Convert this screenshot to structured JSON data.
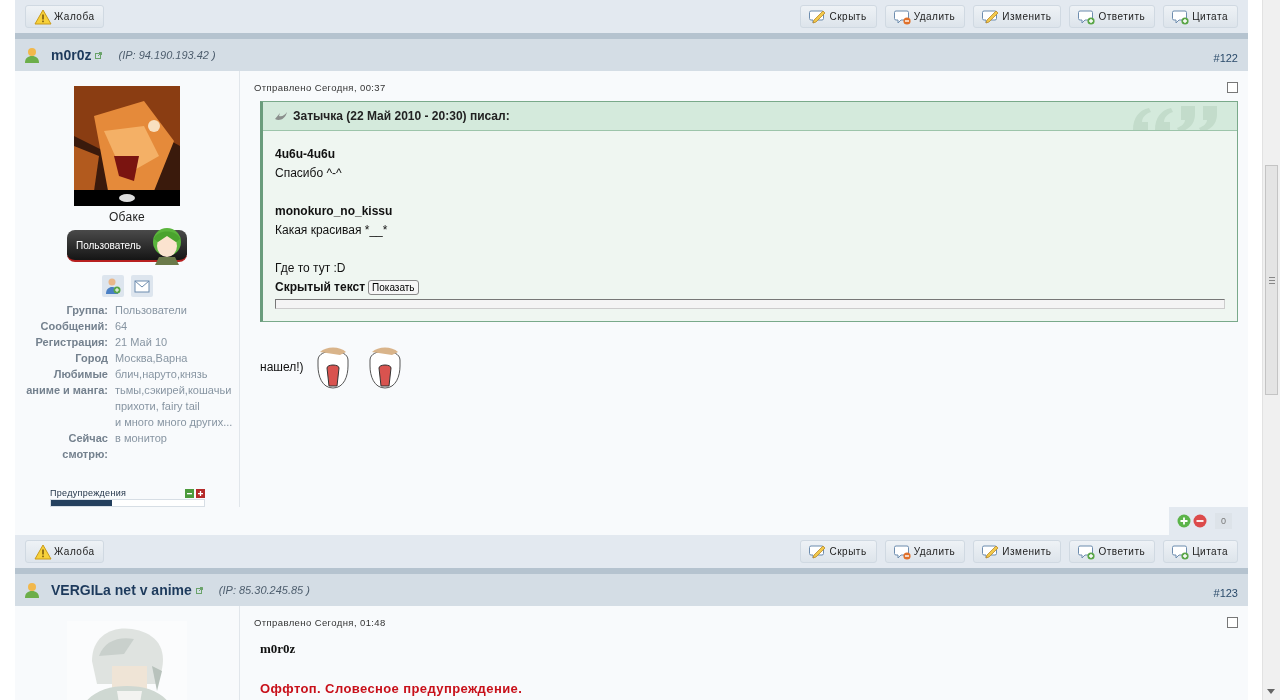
{
  "top_bar": {
    "report": "Жалоба",
    "actions": [
      {
        "kind": "pencil",
        "label": "Скрыть"
      },
      {
        "kind": "remove",
        "label": "Удалить"
      },
      {
        "kind": "pencil",
        "label": "Изменить"
      },
      {
        "kind": "add",
        "label": "Ответить"
      },
      {
        "kind": "add",
        "label": "Цитата"
      }
    ]
  },
  "posts": [
    {
      "header": {
        "name": "m0r0z",
        "ip": "(IP: 94.190.193.42 )",
        "number": "#122"
      },
      "author": {
        "title": "Обаке",
        "rank": "Пользователь",
        "fields": [
          {
            "label": "Группа:",
            "value": [
              "Пользователи"
            ]
          },
          {
            "label": "Сообщений:",
            "value": [
              "64"
            ]
          },
          {
            "label": "Регистрация:",
            "value": [
              "21 Май 10"
            ]
          },
          {
            "label": "Город",
            "value": [
              "Москва,Варна"
            ]
          },
          {
            "label": "Любимые аниме и манга:",
            "value": [
              "блич,наруто,князь тьмы,сэкирей,кошачьи прихоти, fairy tail",
              "и много много других..."
            ]
          },
          {
            "label": "Сейчас смотрю:",
            "value": [
              "в монитор"
            ]
          }
        ],
        "warnings": {
          "label": "Предупреждения",
          "level": 0.4
        }
      },
      "body": {
        "sent": "Отправлено Сегодня, 00:37",
        "checked": false,
        "quote": {
          "header": "Затычка (22 Май 2010 - 20:30) писал:",
          "blocks": [
            {
              "lines": [
                {
                  "text": "4u6u-4u6u",
                  "bold": true
                },
                {
                  "text": "Спасибо ^-^",
                  "bold": false
                }
              ]
            },
            {
              "lines": [
                {
                  "text": "monokuro_no_kissu",
                  "bold": true
                },
                {
                  "text": "Какая красивая *__*",
                  "bold": false
                }
              ]
            },
            {
              "lines": [
                {
                  "text": "Где то тут :D",
                  "bold": false
                }
              ]
            }
          ],
          "spoiler": {
            "label": "Скрытый текст",
            "button": "Показать"
          }
        },
        "lines": [
          {
            "kind": "smilies",
            "text": "нашел!)"
          }
        ]
      },
      "rating": {
        "count": "0"
      },
      "action_bar": {
        "report": "Жалоба",
        "actions": [
          {
            "kind": "pencil",
            "label": "Скрыть"
          },
          {
            "kind": "remove",
            "label": "Удалить"
          },
          {
            "kind": "pencil",
            "label": "Изменить"
          },
          {
            "kind": "add",
            "label": "Ответить"
          },
          {
            "kind": "add",
            "label": "Цитата"
          }
        ]
      }
    },
    {
      "header": {
        "name": "VERGILa net v anime",
        "ip": "(IP: 85.30.245.85 )",
        "number": "#123"
      },
      "body": {
        "sent": "Отправлено Сегодня, 01:48",
        "checked": false,
        "lines": [
          {
            "kind": "name",
            "text": "m0r0z"
          },
          {
            "kind": "warning",
            "text": "Оффтоп. Словесное предупреждение."
          }
        ]
      }
    }
  ]
}
